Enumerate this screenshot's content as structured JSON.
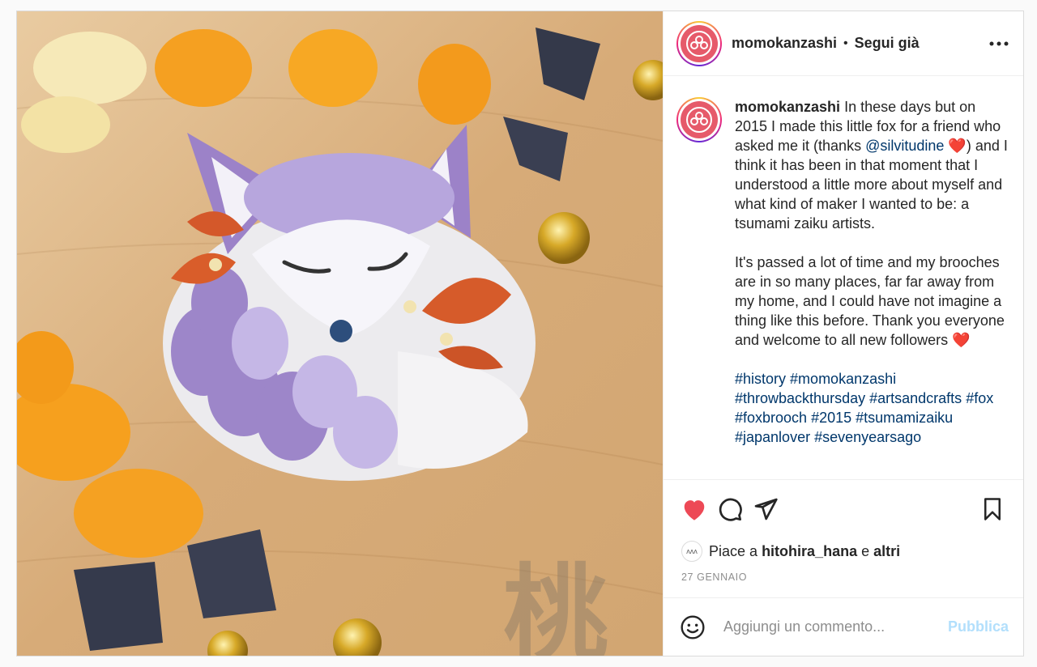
{
  "post": {
    "username": "momokanzashi",
    "follow_status": "Segui già",
    "separator": "•",
    "caption": {
      "username": "momokanzashi",
      "line1_before_mention": "In these days but on 2015 I made this little fox for a friend who asked me it (thanks",
      "mention": "@silvitudine",
      "heart": "❤️",
      "line1_after_mention": ") and I think it has been in that moment that I understood a little more about myself and what kind of maker I wanted to be: a tsumami zaiku artists.",
      "paragraph2": "It's passed a lot of time and my brooches are in so many places, far far away from my home, and I could have not imagine a thing like this before. Thank you everyone and welcome to all new followers",
      "heart2": "❤️",
      "hashtags": [
        "#history",
        "#momokanzashi",
        "#throwbackthursday",
        "#artsandcrafts",
        "#fox",
        "#foxbrooch",
        "#2015",
        "#tsumamizaiku",
        "#japanlover",
        "#sevenyearsago"
      ]
    },
    "likes": {
      "prefix": "Piace a",
      "user": "hitohira_hana",
      "conjunction": "e",
      "others": "altri"
    },
    "date": "27 GENNAIO",
    "comment": {
      "placeholder": "Aggiungi un commento...",
      "publish_label": "Pubblica"
    },
    "colors": {
      "like_red": "#ed4956",
      "link_blue": "#00376b",
      "publish_disabled": "#b2dffc"
    },
    "icons": {
      "like": "heart-icon",
      "comment": "comment-icon",
      "share": "paper-plane-icon",
      "save": "bookmark-icon",
      "more": "more-icon",
      "emoji": "emoji-icon"
    }
  }
}
